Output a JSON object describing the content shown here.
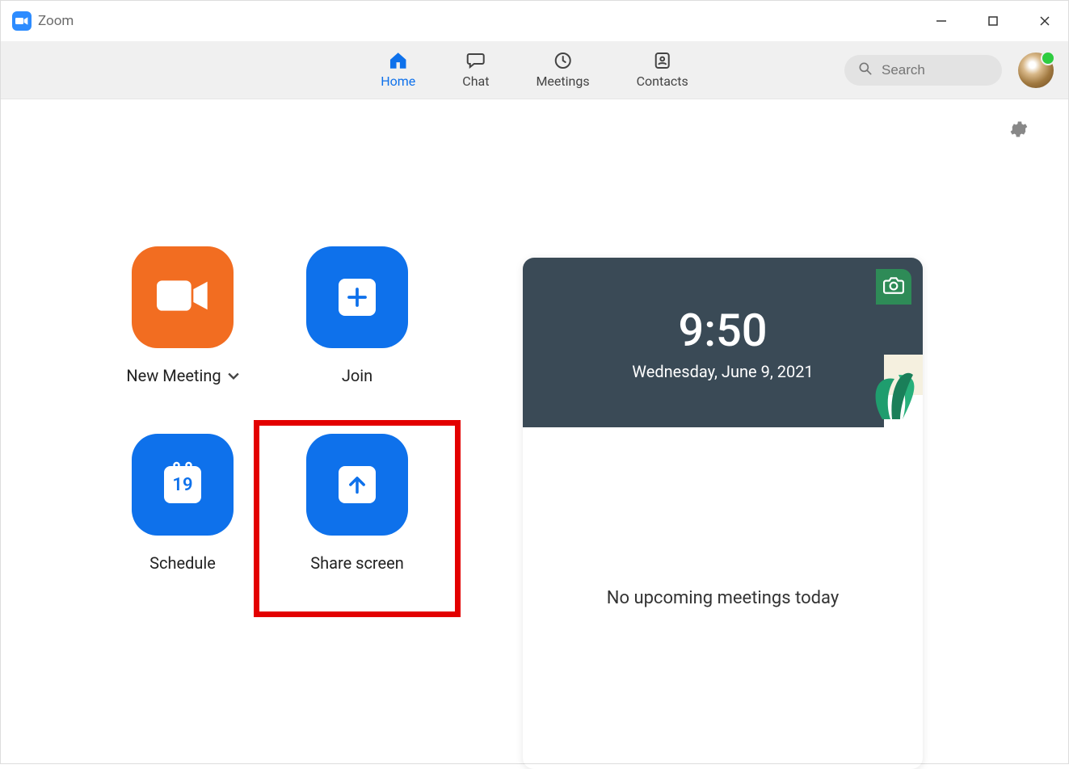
{
  "window": {
    "title": "Zoom"
  },
  "nav": {
    "tabs": [
      {
        "id": "home",
        "label": "Home",
        "active": true
      },
      {
        "id": "chat",
        "label": "Chat",
        "active": false
      },
      {
        "id": "meetings",
        "label": "Meetings",
        "active": false
      },
      {
        "id": "contacts",
        "label": "Contacts",
        "active": false
      }
    ],
    "search_placeholder": "Search"
  },
  "actions": {
    "new_meeting": "New Meeting",
    "join": "Join",
    "schedule": "Schedule",
    "schedule_day": "19",
    "share_screen": "Share screen"
  },
  "panel": {
    "time": "9:50",
    "date": "Wednesday, June 9, 2021",
    "no_meetings": "No upcoming meetings today"
  },
  "colors": {
    "accent_blue": "#0e71eb",
    "accent_orange": "#f26d21",
    "highlight_red": "#e30000",
    "status_green": "#2ecc40"
  },
  "highlighted_action": "share_screen"
}
